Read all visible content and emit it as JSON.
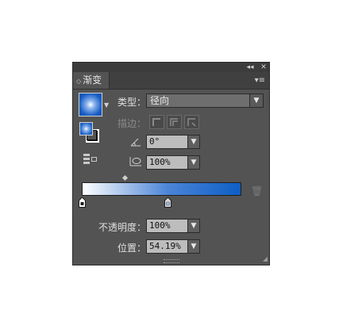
{
  "panel": {
    "tab_title": "渐变",
    "tab_arrows": "◇",
    "collapse_label": "◂◂",
    "close_label": "✕",
    "menu_label": "▾≡"
  },
  "type_row": {
    "label": "类型：",
    "value": "径向"
  },
  "stroke_row": {
    "label": "描边："
  },
  "angle": {
    "value": "0°"
  },
  "aspect": {
    "value": "100%"
  },
  "opacity": {
    "label": "不透明度：",
    "value": "100%"
  },
  "location": {
    "label": "位置：",
    "value": "54.19%"
  },
  "gradient": {
    "start_color": "#ffffff",
    "end_color": "#0d5ec6",
    "selected_stop_position": 54.19
  },
  "colors": {
    "panel_bg": "#535353",
    "accent_blue": "#0d5ec6"
  }
}
